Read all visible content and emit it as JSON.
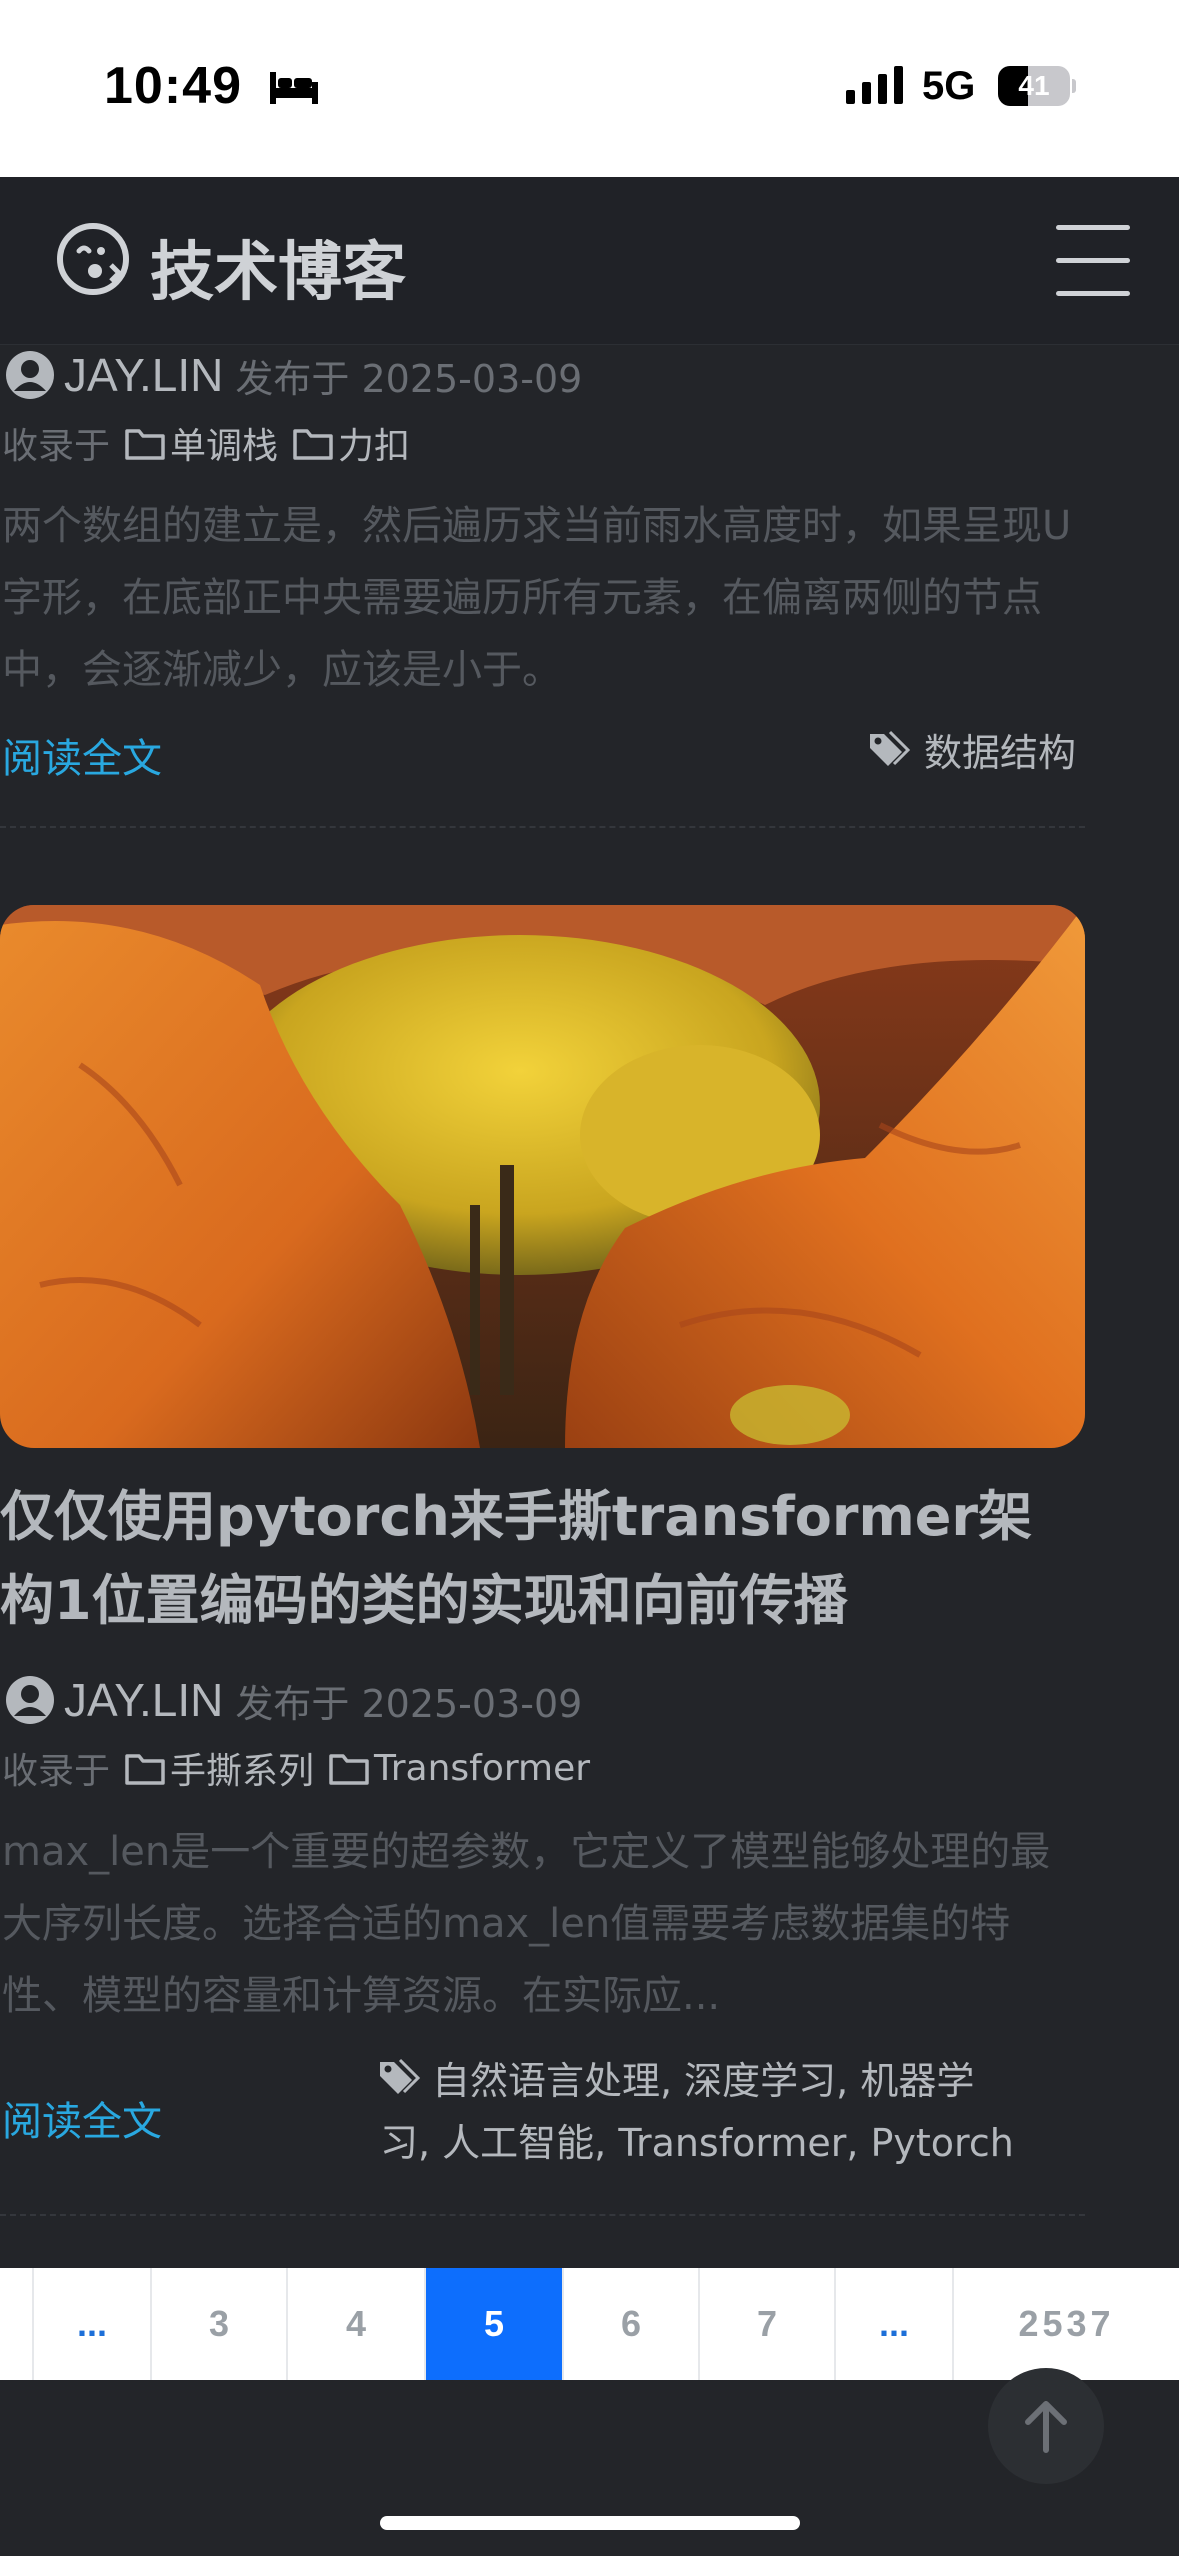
{
  "status_bar": {
    "time": "10:49",
    "network": "5G",
    "battery": "41",
    "battery_level": 0.41
  },
  "header": {
    "title": "技术博客"
  },
  "articles": [
    {
      "author": "JAY.LIN",
      "published": "发布于 2025-03-09",
      "category_prefix": "收录于",
      "categories": [
        "单调栈",
        "力扣"
      ],
      "excerpt": "两个数组的建立是，然后遍历求当前雨水高度时，如果呈现U字形，在底部正中央需要遍历所有元素，在偏离两侧的节点中，会逐渐减少，应该是小于。",
      "read_more": "阅读全文",
      "tags": "数据结构"
    },
    {
      "title": "仅仅使用pytorch来手撕transformer架构1位置编码的类的实现和向前传播",
      "author": "JAY.LIN",
      "published": "发布于 2025-03-09",
      "category_prefix": "收录于",
      "categories": [
        "手撕系列",
        "Transformer"
      ],
      "excerpt": "max_len是一个重要的超参数，它定义了模型能够处理的最大序列长度。选择合适的max_len值需要考虑数据集的特性、模型的容量和计算资源。在实际应...",
      "read_more": "阅读全文",
      "tags_line1": "自然语言处理, 深度学习, 机器学",
      "tags_line2": "习, 人工智能, Transformer, Pytorch"
    }
  ],
  "pagination": {
    "items": [
      "...",
      "3",
      "4",
      "5",
      "6",
      "7",
      "...",
      "2537"
    ],
    "active": "5"
  },
  "colors": {
    "accent": "#0d6efd",
    "link": "#29a8e0",
    "background": "#232529"
  }
}
